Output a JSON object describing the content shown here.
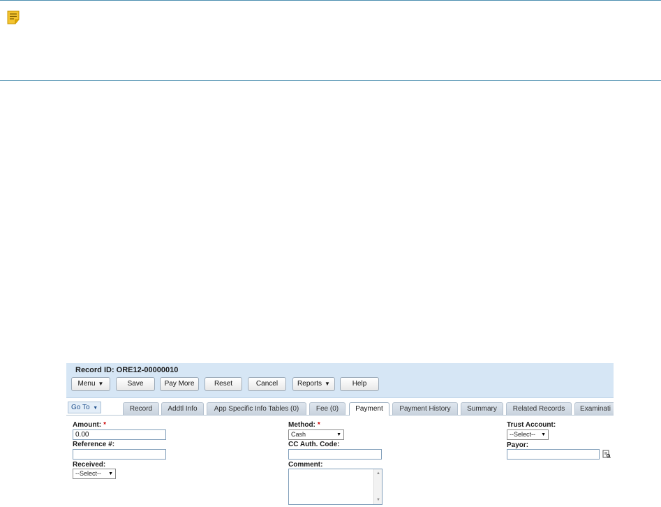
{
  "note": {
    "icon": "note-icon",
    "accent": "#4d8fb0"
  },
  "record": {
    "id_text": "Record ID: ORE12-00000010"
  },
  "toolbar": {
    "menu": "Menu",
    "save": "Save",
    "pay_more": "Pay More",
    "reset": "Reset",
    "cancel": "Cancel",
    "reports": "Reports",
    "help": "Help"
  },
  "nav": {
    "goto": "Go To",
    "tabs": [
      "Record",
      "Addtl Info",
      "App Specific Info Tables (0)",
      "Fee (0)",
      "Payment",
      "Payment History",
      "Summary",
      "Related Records",
      "Examinati"
    ],
    "active_tab": "Payment"
  },
  "form": {
    "amount_label": "Amount:",
    "amount_value": "0.00",
    "reference_label": "Reference #:",
    "reference_value": "",
    "received_label": "Received:",
    "received_value": "--Select--",
    "method_label": "Method:",
    "method_value": "Cash",
    "cc_label": "CC Auth. Code:",
    "cc_value": "",
    "comment_label": "Comment:",
    "trust_label": "Trust Account:",
    "trust_value": "--Select--",
    "payor_label": "Payor:",
    "payor_value": "",
    "required_mark": "*"
  }
}
